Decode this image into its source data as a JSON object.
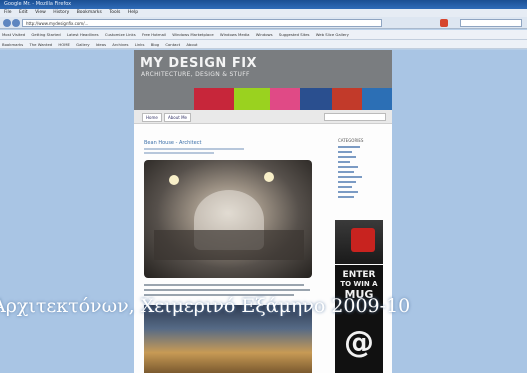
{
  "window": {
    "title": "Google Mr. - Mozilla Firefox"
  },
  "menubar": [
    "File",
    "Edit",
    "View",
    "History",
    "Bookmarks",
    "Tools",
    "Help"
  ],
  "address": {
    "url": "http://www.mydesignfix.com/..."
  },
  "bookmarks_row1": [
    "Most Visited",
    "Getting Started",
    "Latest Headlines",
    "Customize Links",
    "Free Hotmail",
    "Windows Marketplace",
    "Windows Media",
    "Windows",
    "Suggested Sites",
    "Web Slice Gallery"
  ],
  "bookmarks_row2": [
    "Bookmarks",
    "The Wanted",
    "HOME",
    "Gallery",
    "Ideas",
    "Archives",
    "Links",
    "Blog",
    "Contact",
    "About"
  ],
  "site": {
    "logo": "MY DESIGN FIX",
    "tagline": "ARCHITECTURE, DESIGN & STUFF",
    "tabs": [
      "Home",
      "About Me"
    ],
    "post_title": "Bean House - Architect",
    "sidebar_title": "CATEGORIES",
    "ad_text": {
      "line1": "ENTER",
      "line2": "TO WIN A",
      "line3": "MUG",
      "symbol": "@"
    }
  },
  "caption": "Αρχιτεκτόνων, Χειμερινό Εξάμηνο 2009-10"
}
